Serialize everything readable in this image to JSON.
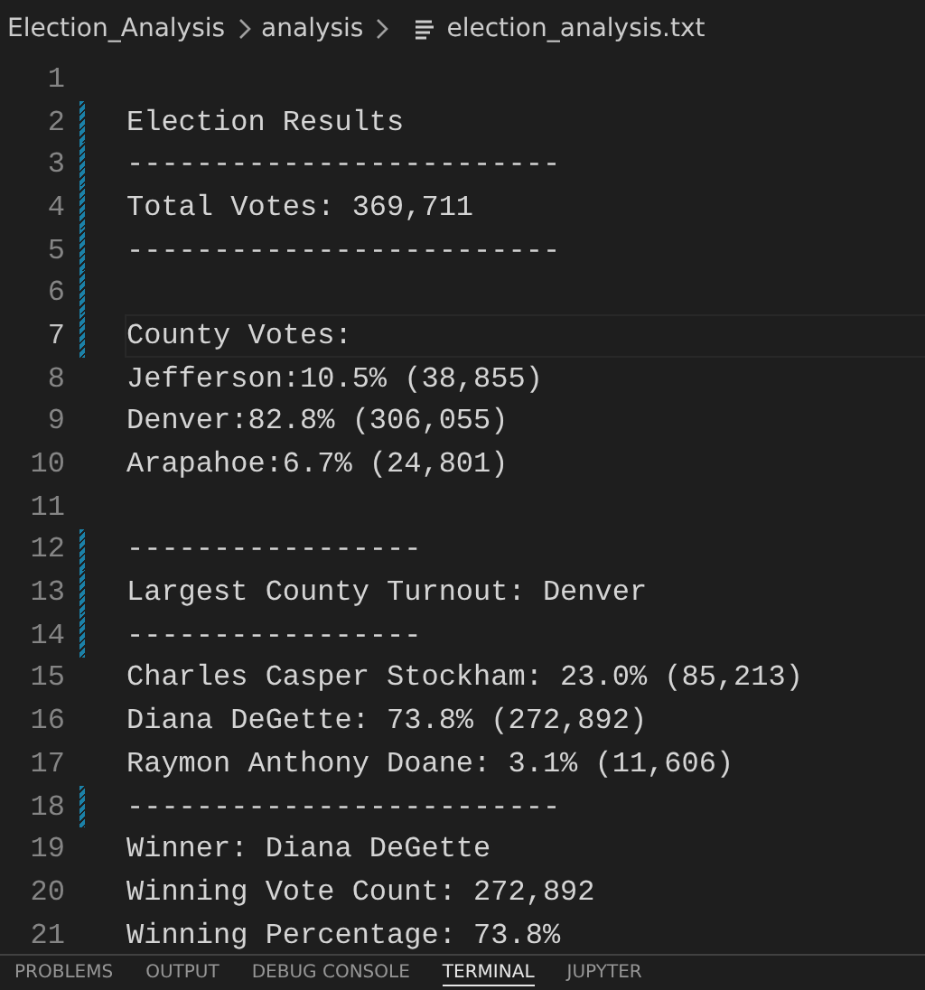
{
  "breadcrumb": {
    "segments": [
      "Election_Analysis",
      "analysis"
    ],
    "file": "election_analysis.txt"
  },
  "editor": {
    "lines": [
      {
        "number": "1",
        "modified": false,
        "selected": false
      },
      {
        "number": "2",
        "text": "Election Results",
        "modified": true,
        "selected": false
      },
      {
        "number": "3",
        "text": "-------------------------",
        "modified": true,
        "selected": false
      },
      {
        "number": "4",
        "text": "Total Votes: 369,711",
        "modified": true,
        "selected": false
      },
      {
        "number": "5",
        "text": "-------------------------",
        "modified": true,
        "selected": false
      },
      {
        "number": "6",
        "modified": true,
        "selected": false
      },
      {
        "number": "7",
        "text": "County Votes:",
        "modified": true,
        "selected": true
      },
      {
        "number": "8",
        "text": "Jefferson:10.5% (38,855)",
        "modified": false,
        "selected": false
      },
      {
        "number": "9",
        "text": "Denver:82.8% (306,055)",
        "modified": false,
        "selected": false
      },
      {
        "number": "10",
        "text": "Arapahoe:6.7% (24,801)",
        "modified": false,
        "selected": false
      },
      {
        "number": "11",
        "modified": false,
        "selected": false
      },
      {
        "number": "12",
        "text": "-----------------",
        "modified": true,
        "selected": false
      },
      {
        "number": "13",
        "text": "Largest County Turnout: Denver",
        "modified": true,
        "selected": false
      },
      {
        "number": "14",
        "text": "-----------------",
        "modified": true,
        "selected": false
      },
      {
        "number": "15",
        "text": "Charles Casper Stockham: 23.0% (85,213)",
        "modified": false,
        "selected": false
      },
      {
        "number": "16",
        "text": "Diana DeGette: 73.8% (272,892)",
        "modified": false,
        "selected": false
      },
      {
        "number": "17",
        "text": "Raymon Anthony Doane: 3.1% (11,606)",
        "modified": false,
        "selected": false
      },
      {
        "number": "18",
        "text": "-------------------------",
        "modified": true,
        "selected": false
      },
      {
        "number": "19",
        "text": "Winner: Diana DeGette",
        "modified": false,
        "selected": false
      },
      {
        "number": "20",
        "text": "Winning Vote Count: 272,892",
        "modified": false,
        "selected": false
      },
      {
        "number": "21",
        "text": "Winning Percentage: 73.8%",
        "modified": false,
        "selected": false
      }
    ]
  },
  "panel_tabs": [
    {
      "label": "PROBLEMS",
      "selected": false
    },
    {
      "label": "OUTPUT",
      "selected": false
    },
    {
      "label": "DEBUG CONSOLE",
      "selected": false
    },
    {
      "label": "TERMINAL",
      "selected": true
    },
    {
      "label": "JUPYTER",
      "selected": false
    }
  ]
}
